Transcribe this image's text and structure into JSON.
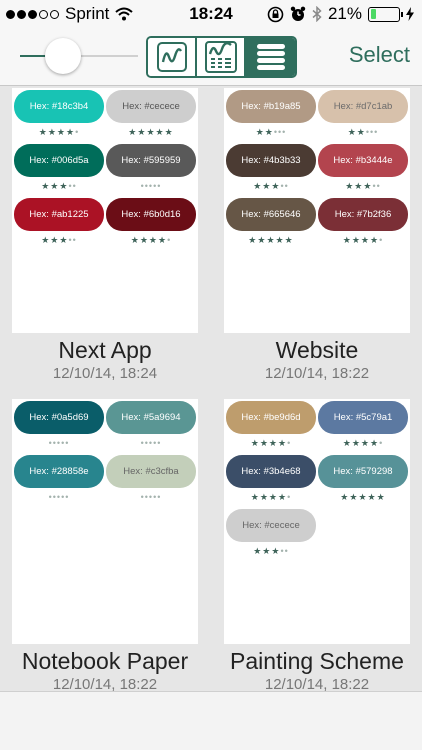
{
  "status": {
    "carrier": "Sprint",
    "time": "18:24",
    "battery": "21%"
  },
  "toolbar": {
    "select_label": "Select",
    "slider_value": 0.3,
    "active_view": "list-view"
  },
  "projects": [
    {
      "title": "",
      "date": "",
      "swatches": [
        {
          "label": "Hex: #18c3b4",
          "color": "#18c3b4",
          "text_color": "#ffffff",
          "rating": 4
        },
        {
          "label": "Hex: #cecece",
          "color": "#cecece",
          "text_color": "#555555",
          "rating": 5
        },
        {
          "label": "Hex: #006d5a",
          "color": "#006d5a",
          "text_color": "#ffffff",
          "rating": 3
        },
        {
          "label": "Hex: #595959",
          "color": "#595959",
          "text_color": "#ffffff",
          "rating": 0
        },
        {
          "label": "Hex: #ab1225",
          "color": "#ab1225",
          "text_color": "#ffffff",
          "rating": 3
        },
        {
          "label": "Hex: #6b0d16",
          "color": "#6b0d16",
          "text_color": "#ffffff",
          "rating": 4
        }
      ]
    },
    {
      "title": "",
      "date": "",
      "swatches": [
        {
          "label": "Hex: #b19a85",
          "color": "#b19a85",
          "text_color": "#ffffff",
          "rating": 2
        },
        {
          "label": "Hex: #d7c1ab",
          "color": "#d7c1ab",
          "text_color": "#6b6b6b",
          "rating": 2
        },
        {
          "label": "Hex: #4b3b33",
          "color": "#4b3b33",
          "text_color": "#ffffff",
          "rating": 3
        },
        {
          "label": "Hex: #b3444e",
          "color": "#b3444e",
          "text_color": "#ffffff",
          "rating": 3
        },
        {
          "label": "Hex: #665646",
          "color": "#665646",
          "text_color": "#ffffff",
          "rating": 5
        },
        {
          "label": "Hex: #7b2f36",
          "color": "#7b2f36",
          "text_color": "#ffffff",
          "rating": 4
        }
      ]
    },
    {
      "title": "Next App",
      "date": "12/10/14, 18:24",
      "swatches": []
    },
    {
      "title": "Website",
      "date": "12/10/14, 18:22",
      "swatches": []
    },
    {
      "title": "",
      "date": "",
      "swatches": [
        {
          "label": "Hex: #0a5d69",
          "color": "#0a5d69",
          "text_color": "#ffffff",
          "rating": 0
        },
        {
          "label": "Hex: #5a9694",
          "color": "#5a9694",
          "text_color": "#ffffff",
          "rating": 0
        },
        {
          "label": "Hex: #28858e",
          "color": "#28858e",
          "text_color": "#ffffff",
          "rating": 0
        },
        {
          "label": "Hex: #c3cfba",
          "color": "#c3cfba",
          "text_color": "#666666",
          "rating": 0
        }
      ]
    },
    {
      "title": "",
      "date": "",
      "swatches": [
        {
          "label": "Hex: #be9d6d",
          "color": "#be9d6d",
          "text_color": "#ffffff",
          "rating": 4
        },
        {
          "label": "Hex: #5c79a1",
          "color": "#5c79a1",
          "text_color": "#ffffff",
          "rating": 4
        },
        {
          "label": "Hex: #3b4e68",
          "color": "#3b4e68",
          "text_color": "#ffffff",
          "rating": 4
        },
        {
          "label": "Hex: #579298",
          "color": "#579298",
          "text_color": "#ffffff",
          "rating": 5
        },
        {
          "label": "Hex: #cecece",
          "color": "#cecece",
          "text_color": "#666666",
          "rating": 3
        }
      ]
    },
    {
      "title": "Notebook Paper",
      "date": "12/10/14, 18:22",
      "swatches": []
    },
    {
      "title": "Painting Scheme",
      "date": "12/10/14, 18:22",
      "swatches": []
    }
  ]
}
